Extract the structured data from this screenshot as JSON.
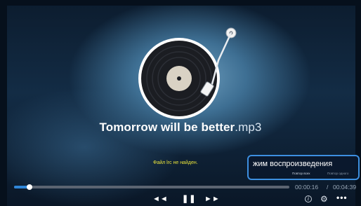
{
  "now_playing": {
    "title": "Tomorrow will be better",
    "extension": ".mp3"
  },
  "lyrics": {
    "message": "Файл lrc не найден."
  },
  "playback_mode_menu": {
    "title": "жим воспроизведения",
    "options": [
      "Повтор всех",
      "Повтор одного"
    ]
  },
  "progress": {
    "current_time": "00:00:16",
    "separator": "/",
    "total_time": "00:04:39",
    "fraction": 0.057
  },
  "controls": {
    "prev_icon": "rewind-icon",
    "pause_icon": "pause-icon",
    "next_icon": "fast-forward-icon",
    "prev_glyph": "◄◄",
    "pause_glyph": "❚❚",
    "next_glyph": "►►",
    "info_glyph": "i",
    "settings_glyph": "⚙",
    "more_glyph": "•••"
  },
  "colors": {
    "accent": "#2f86d8",
    "lyrics_text": "#e8e23a",
    "panel_border": "#3d8fe0"
  }
}
